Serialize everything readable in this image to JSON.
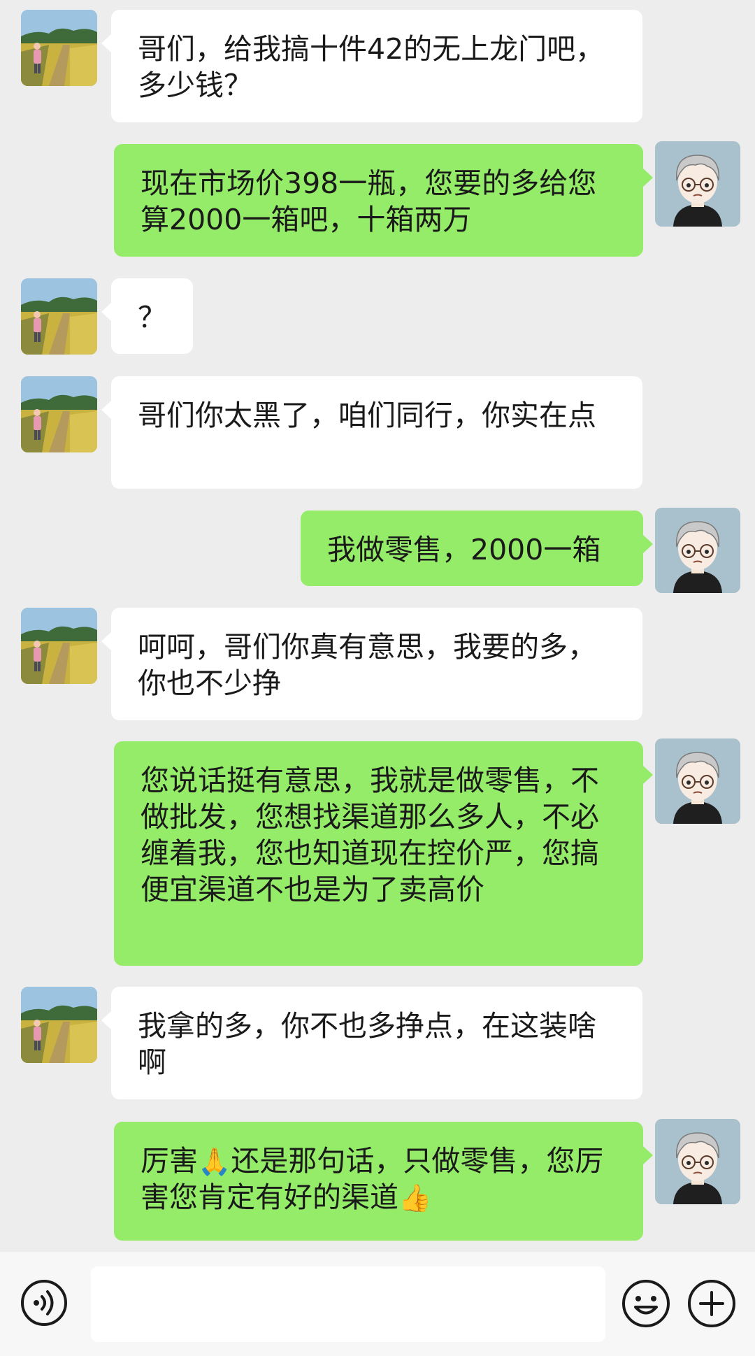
{
  "messages": [
    {
      "side": "in",
      "text": "哥们，给我搞十件42的无上龙门吧，多少钱？"
    },
    {
      "side": "out",
      "text": "现在市场价398一瓶，您要的多给您算2000一箱吧，十箱两万"
    },
    {
      "side": "in",
      "text": "？"
    },
    {
      "side": "in",
      "text": "哥们你太黑了，咱们同行，你实在点"
    },
    {
      "side": "out",
      "text": "我做零售，2000一箱"
    },
    {
      "side": "in",
      "text": "呵呵，哥们你真有意思，我要的多，你也不少挣"
    },
    {
      "side": "out",
      "text": "您说话挺有意思，我就是做零售，不做批发，您想找渠道那么多人，不必缠着我，您也知道现在控价严，您搞便宜渠道不也是为了卖高价"
    },
    {
      "side": "in",
      "text": "我拿的多，你不也多挣点，在这装啥啊"
    },
    {
      "side": "out",
      "text_a": "厉害",
      "emoji_a": "🙏",
      "text_b": "还是那句话，只做零售，您厉害您肯定有好的渠道",
      "emoji_b": "👍"
    }
  ],
  "input": {
    "value": "",
    "placeholder": ""
  },
  "icons": {
    "voice": "voice-input-icon",
    "emoji": "emoji-smiley-icon",
    "plus": "plus-more-icon"
  },
  "colors": {
    "background": "#ededed",
    "outgoing_bubble": "#95ec69",
    "incoming_bubble": "#ffffff"
  }
}
